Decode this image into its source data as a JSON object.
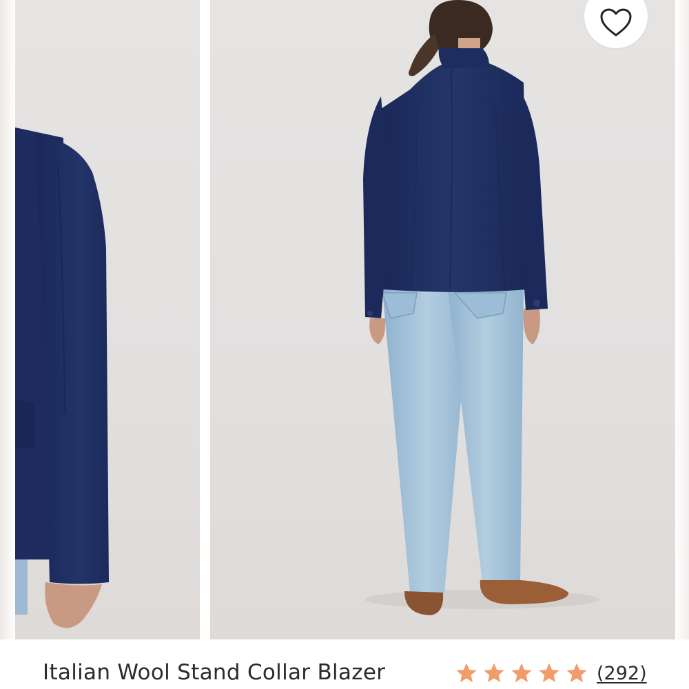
{
  "product": {
    "title": "Italian Wool Stand Collar Blazer",
    "rating_value": 5,
    "rating_max": 5,
    "review_count": "292",
    "star_color": "#f29b6b"
  },
  "gallery": {
    "images": [
      {
        "name": "sleeve-detail-image"
      },
      {
        "name": "back-view-image"
      }
    ]
  },
  "icons": {
    "wishlist": "heart-icon",
    "star": "star-icon"
  },
  "colors": {
    "jacket_navy": "#1f2f63",
    "denim": "#a9c6dc",
    "background": "#e4e2e1"
  }
}
